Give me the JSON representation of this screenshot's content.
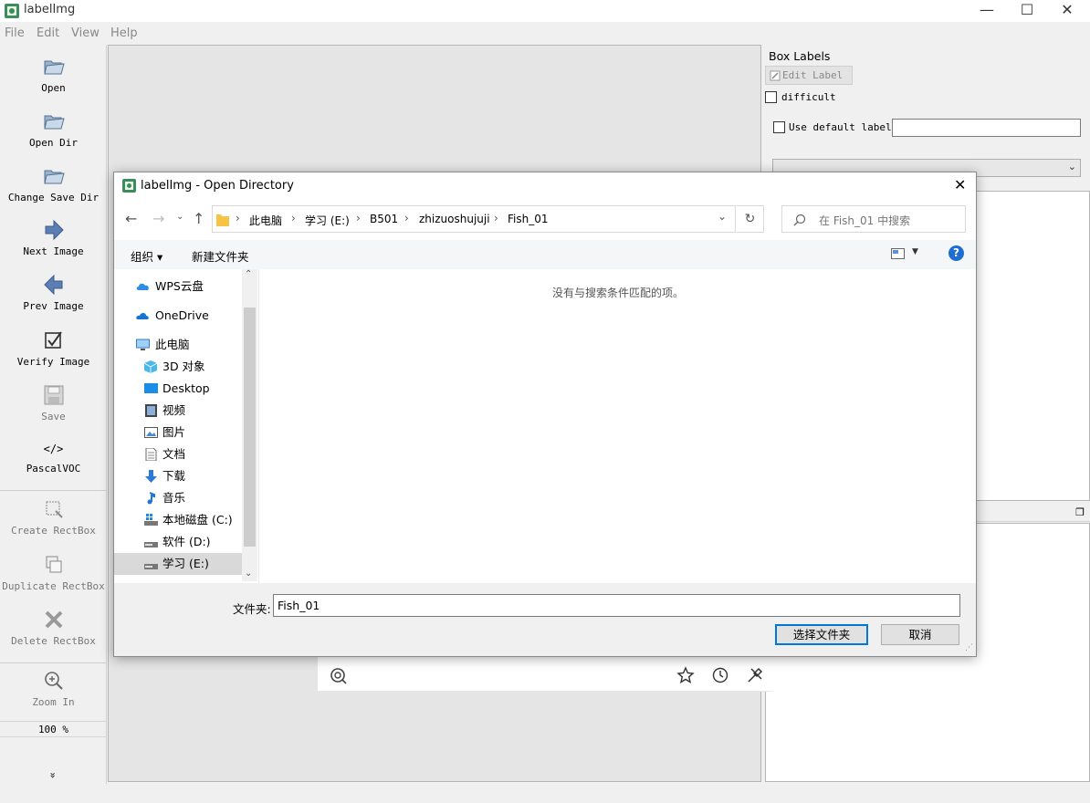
{
  "app": {
    "title": "labelImg",
    "menu": [
      "File",
      "Edit",
      "View",
      "Help"
    ],
    "toolbar": {
      "open": "Open",
      "open_dir": "Open Dir",
      "change_save_dir": "Change Save Dir",
      "next_image": "Next Image",
      "prev_image": "Prev Image",
      "verify_image": "Verify Image",
      "save": "Save",
      "format_icon": "</>",
      "format": "PascalVOC",
      "create_rectbox": "Create RectBox",
      "duplicate_rectbox": "Duplicate RectBox",
      "delete_rectbox": "Delete RectBox",
      "zoom_in": "Zoom In",
      "zoom_level": "100 %",
      "more": "»"
    },
    "right_panel": {
      "title": "Box Labels",
      "edit_label": "Edit Label",
      "difficult": "difficult",
      "use_default_label": "Use default label",
      "default_label_value": ""
    }
  },
  "dialog": {
    "title": "labelImg - Open Directory",
    "breadcrumb": [
      "此电脑",
      "学习 (E:)",
      "B501",
      "zhizuoshujuji",
      "Fish_01"
    ],
    "search_placeholder": "在 Fish_01 中搜索",
    "organize": "组织 ▾",
    "new_folder": "新建文件夹",
    "help": "?",
    "nav_items": [
      {
        "label": "WPS云盘",
        "icon": "cloud-icon"
      },
      {
        "label": "OneDrive",
        "icon": "onedrive-icon"
      },
      {
        "label": "此电脑",
        "icon": "computer-icon"
      },
      {
        "label": "3D 对象",
        "icon": "3d-objects-icon"
      },
      {
        "label": "Desktop",
        "icon": "desktop-icon"
      },
      {
        "label": "视频",
        "icon": "video-icon"
      },
      {
        "label": "图片",
        "icon": "picture-icon"
      },
      {
        "label": "文档",
        "icon": "document-icon"
      },
      {
        "label": "下载",
        "icon": "download-icon"
      },
      {
        "label": "音乐",
        "icon": "music-icon"
      },
      {
        "label": "本地磁盘 (C:)",
        "icon": "drive-icon"
      },
      {
        "label": "软件 (D:)",
        "icon": "drive-icon"
      },
      {
        "label": "学习 (E:)",
        "icon": "drive-icon"
      }
    ],
    "empty_message": "没有与搜索条件匹配的项。",
    "folder_label": "文件夹:",
    "folder_value": "Fish_01",
    "select_button": "选择文件夹",
    "cancel_button": "取消"
  },
  "colors": {
    "accent": "#0078d7",
    "folder": "#f6c342",
    "selected_nav": "#cce8ff"
  }
}
